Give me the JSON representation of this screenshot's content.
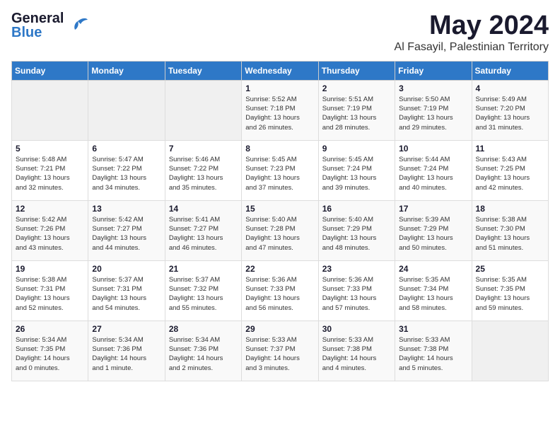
{
  "logo": {
    "name_part1": "General",
    "name_part2": "Blue",
    "tagline": "Blue"
  },
  "header": {
    "month": "May 2024",
    "location": "Al Fasayil, Palestinian Territory"
  },
  "weekdays": [
    "Sunday",
    "Monday",
    "Tuesday",
    "Wednesday",
    "Thursday",
    "Friday",
    "Saturday"
  ],
  "weeks": [
    [
      {
        "day": "",
        "info": ""
      },
      {
        "day": "",
        "info": ""
      },
      {
        "day": "",
        "info": ""
      },
      {
        "day": "1",
        "info": "Sunrise: 5:52 AM\nSunset: 7:18 PM\nDaylight: 13 hours\nand 26 minutes."
      },
      {
        "day": "2",
        "info": "Sunrise: 5:51 AM\nSunset: 7:19 PM\nDaylight: 13 hours\nand 28 minutes."
      },
      {
        "day": "3",
        "info": "Sunrise: 5:50 AM\nSunset: 7:19 PM\nDaylight: 13 hours\nand 29 minutes."
      },
      {
        "day": "4",
        "info": "Sunrise: 5:49 AM\nSunset: 7:20 PM\nDaylight: 13 hours\nand 31 minutes."
      }
    ],
    [
      {
        "day": "5",
        "info": "Sunrise: 5:48 AM\nSunset: 7:21 PM\nDaylight: 13 hours\nand 32 minutes."
      },
      {
        "day": "6",
        "info": "Sunrise: 5:47 AM\nSunset: 7:22 PM\nDaylight: 13 hours\nand 34 minutes."
      },
      {
        "day": "7",
        "info": "Sunrise: 5:46 AM\nSunset: 7:22 PM\nDaylight: 13 hours\nand 35 minutes."
      },
      {
        "day": "8",
        "info": "Sunrise: 5:45 AM\nSunset: 7:23 PM\nDaylight: 13 hours\nand 37 minutes."
      },
      {
        "day": "9",
        "info": "Sunrise: 5:45 AM\nSunset: 7:24 PM\nDaylight: 13 hours\nand 39 minutes."
      },
      {
        "day": "10",
        "info": "Sunrise: 5:44 AM\nSunset: 7:24 PM\nDaylight: 13 hours\nand 40 minutes."
      },
      {
        "day": "11",
        "info": "Sunrise: 5:43 AM\nSunset: 7:25 PM\nDaylight: 13 hours\nand 42 minutes."
      }
    ],
    [
      {
        "day": "12",
        "info": "Sunrise: 5:42 AM\nSunset: 7:26 PM\nDaylight: 13 hours\nand 43 minutes."
      },
      {
        "day": "13",
        "info": "Sunrise: 5:42 AM\nSunset: 7:27 PM\nDaylight: 13 hours\nand 44 minutes."
      },
      {
        "day": "14",
        "info": "Sunrise: 5:41 AM\nSunset: 7:27 PM\nDaylight: 13 hours\nand 46 minutes."
      },
      {
        "day": "15",
        "info": "Sunrise: 5:40 AM\nSunset: 7:28 PM\nDaylight: 13 hours\nand 47 minutes."
      },
      {
        "day": "16",
        "info": "Sunrise: 5:40 AM\nSunset: 7:29 PM\nDaylight: 13 hours\nand 48 minutes."
      },
      {
        "day": "17",
        "info": "Sunrise: 5:39 AM\nSunset: 7:29 PM\nDaylight: 13 hours\nand 50 minutes."
      },
      {
        "day": "18",
        "info": "Sunrise: 5:38 AM\nSunset: 7:30 PM\nDaylight: 13 hours\nand 51 minutes."
      }
    ],
    [
      {
        "day": "19",
        "info": "Sunrise: 5:38 AM\nSunset: 7:31 PM\nDaylight: 13 hours\nand 52 minutes."
      },
      {
        "day": "20",
        "info": "Sunrise: 5:37 AM\nSunset: 7:31 PM\nDaylight: 13 hours\nand 54 minutes."
      },
      {
        "day": "21",
        "info": "Sunrise: 5:37 AM\nSunset: 7:32 PM\nDaylight: 13 hours\nand 55 minutes."
      },
      {
        "day": "22",
        "info": "Sunrise: 5:36 AM\nSunset: 7:33 PM\nDaylight: 13 hours\nand 56 minutes."
      },
      {
        "day": "23",
        "info": "Sunrise: 5:36 AM\nSunset: 7:33 PM\nDaylight: 13 hours\nand 57 minutes."
      },
      {
        "day": "24",
        "info": "Sunrise: 5:35 AM\nSunset: 7:34 PM\nDaylight: 13 hours\nand 58 minutes."
      },
      {
        "day": "25",
        "info": "Sunrise: 5:35 AM\nSunset: 7:35 PM\nDaylight: 13 hours\nand 59 minutes."
      }
    ],
    [
      {
        "day": "26",
        "info": "Sunrise: 5:34 AM\nSunset: 7:35 PM\nDaylight: 14 hours\nand 0 minutes."
      },
      {
        "day": "27",
        "info": "Sunrise: 5:34 AM\nSunset: 7:36 PM\nDaylight: 14 hours\nand 1 minute."
      },
      {
        "day": "28",
        "info": "Sunrise: 5:34 AM\nSunset: 7:36 PM\nDaylight: 14 hours\nand 2 minutes."
      },
      {
        "day": "29",
        "info": "Sunrise: 5:33 AM\nSunset: 7:37 PM\nDaylight: 14 hours\nand 3 minutes."
      },
      {
        "day": "30",
        "info": "Sunrise: 5:33 AM\nSunset: 7:38 PM\nDaylight: 14 hours\nand 4 minutes."
      },
      {
        "day": "31",
        "info": "Sunrise: 5:33 AM\nSunset: 7:38 PM\nDaylight: 14 hours\nand 5 minutes."
      },
      {
        "day": "",
        "info": ""
      }
    ]
  ]
}
